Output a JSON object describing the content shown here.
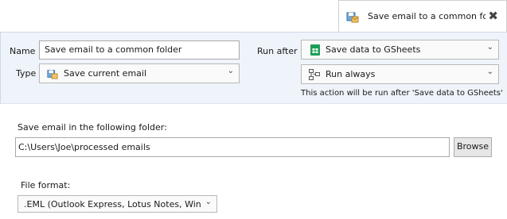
{
  "tab": {
    "title": "Save email to a common fc",
    "close_glyph": "✖",
    "icon": "save-email-icon"
  },
  "header": {
    "name_label": "Name",
    "name_value": "Save email to a common folder",
    "type_label": "Type",
    "type_value": "Save current email",
    "type_icon": "save-email-icon",
    "run_after_label": "Run after",
    "run_after_value": "Save data to GSheets",
    "run_after_icon": "google-sheets-icon",
    "run_condition_value": "Run always",
    "run_condition_icon": "flow-chart-icon",
    "info_text": "This action will be run after 'Save data to GSheets'"
  },
  "main": {
    "folder_label": "Save email in the following folder:",
    "folder_value": "C:\\Users\\Joe\\processed emails",
    "browse_label": "Browse",
    "format_label": "File format:",
    "format_value": ".EML (Outlook Express, Lotus Notes, Windo"
  },
  "colors": {
    "header_bg": "#eef4fa",
    "sheets_green": "#1e9d58"
  }
}
